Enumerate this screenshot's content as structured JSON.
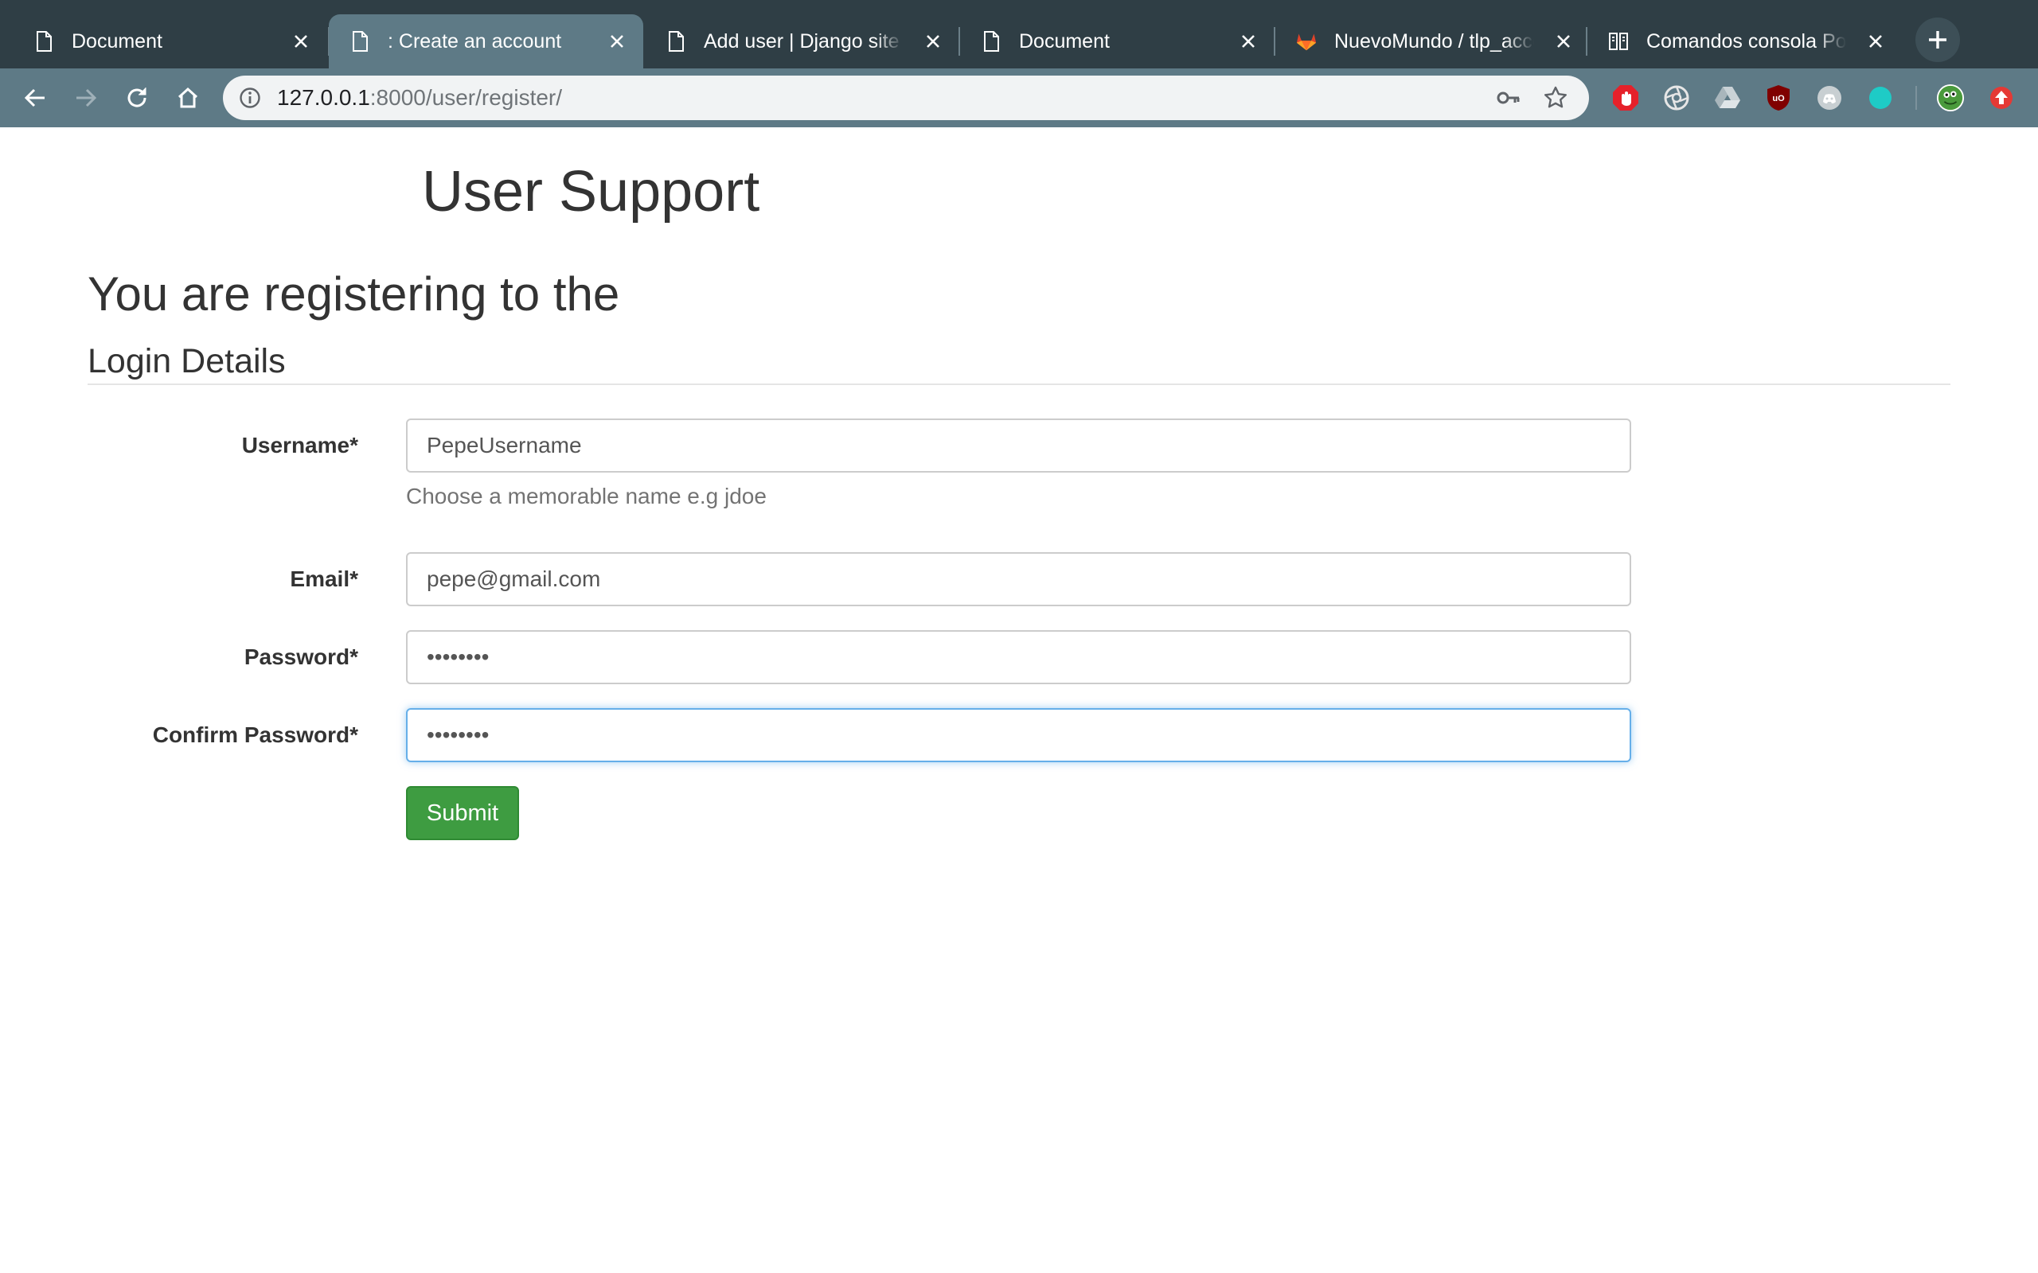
{
  "browser": {
    "tabs": [
      {
        "title": "Document",
        "icon": "document-icon",
        "active": false
      },
      {
        "title": ": Create an account",
        "icon": "document-icon",
        "active": true
      },
      {
        "title": "Add user | Django site admin",
        "icon": "document-icon",
        "active": false
      },
      {
        "title": "Document",
        "icon": "document-icon",
        "active": false
      },
      {
        "title": "NuevoMundo / tlp_accounts",
        "icon": "gitlab-icon",
        "active": false
      },
      {
        "title": "Comandos consola PostgreSQL",
        "icon": "book-icon",
        "active": false
      }
    ],
    "address": {
      "host": "127.0.0.1",
      "path": ":8000/user/register/"
    },
    "extensions": [
      "adblock-icon",
      "camera-aperture-icon",
      "google-drive-icon",
      "ublock-origin-icon",
      "discord-icon",
      "teal-circle-icon",
      "profile-avatar",
      "update-icon"
    ],
    "colors": {
      "tabstrip": "#2f3e45",
      "toolbar": "#5e7a86"
    }
  },
  "page": {
    "site_title": "User Support",
    "heading": "You are registering to the",
    "section": "Login Details",
    "fields": {
      "username": {
        "label": "Username*",
        "value": "PepeUsername",
        "help": "Choose a memorable name e.g jdoe"
      },
      "email": {
        "label": "Email*",
        "value": "pepe@gmail.com"
      },
      "password": {
        "label": "Password*",
        "value": "••••••••"
      },
      "confirm_password": {
        "label": "Confirm Password*",
        "value": "••••••••"
      }
    },
    "submit_label": "Submit",
    "colors": {
      "submit": "#3e9c41",
      "focus": "#66afe9"
    }
  }
}
